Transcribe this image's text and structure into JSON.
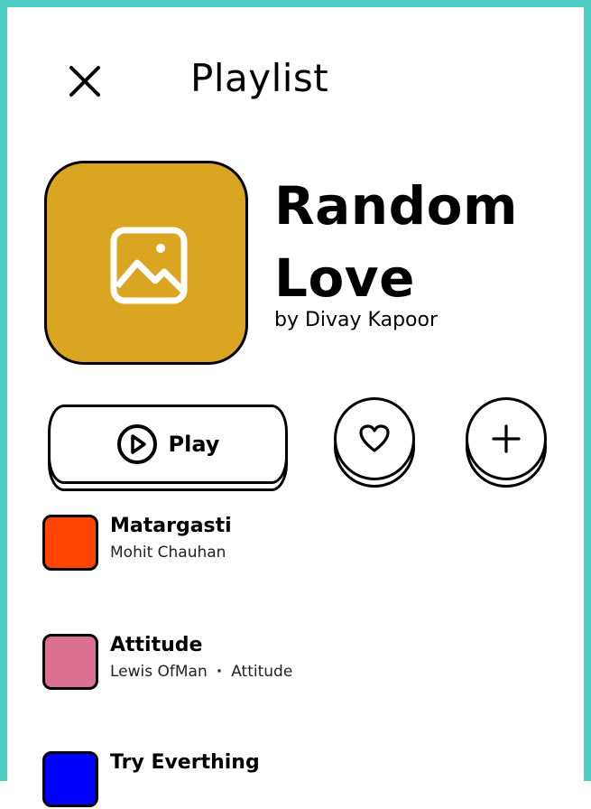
{
  "header": {
    "title": "Playlist",
    "close_icon": "close-icon"
  },
  "playlist": {
    "title": "Random Love",
    "author": "by Divay Kapoor",
    "cover_color": "#DAA520",
    "cover_icon": "image-icon"
  },
  "actions": {
    "play_label": "Play",
    "play_icon": "play-circle-icon",
    "like_icon": "heart-icon",
    "add_icon": "plus-icon"
  },
  "tracks": [
    {
      "title": "Matargasti",
      "artist": "Mohit Chauhan",
      "album": "",
      "color": "#FF4500"
    },
    {
      "title": "Attitude",
      "artist": "Lewis OfMan",
      "album": "Attitude",
      "color": "#DB7093"
    },
    {
      "title": "Try Everthing",
      "artist": "",
      "album": "",
      "color": "#0000FF"
    }
  ],
  "theme": {
    "frame_color": "#4ECDC4"
  }
}
